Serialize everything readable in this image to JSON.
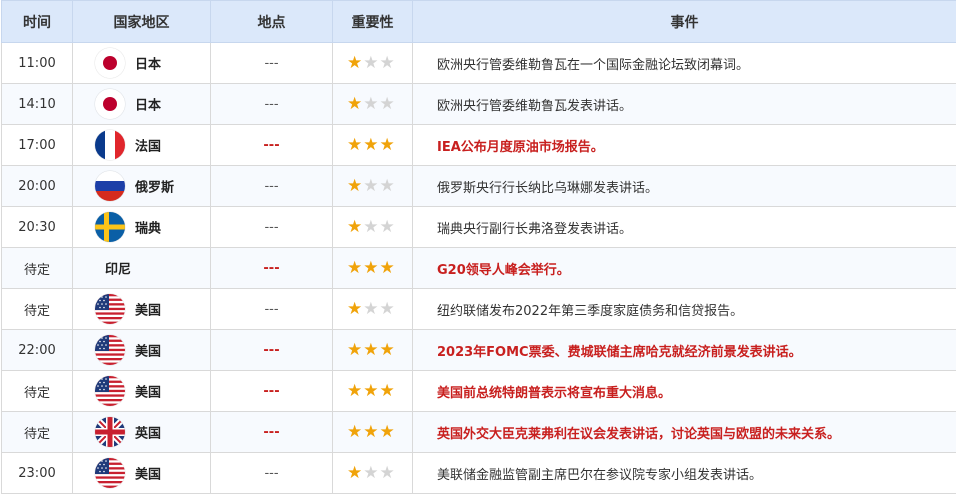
{
  "header": {
    "time": "时间",
    "country": "国家地区",
    "place": "地点",
    "importance": "重要性",
    "event": "事件"
  },
  "rows": [
    {
      "time": "11:00",
      "country": "日本",
      "flag": "japan-flag-icon",
      "place": "---",
      "stars": 1,
      "event": "欧洲央行管委维勒鲁瓦在一个国际金融论坛致闭幕词。",
      "highlight": false
    },
    {
      "time": "14:10",
      "country": "日本",
      "flag": "japan-flag-icon",
      "place": "---",
      "stars": 1,
      "event": "欧洲央行管委维勒鲁瓦发表讲话。",
      "highlight": false
    },
    {
      "time": "17:00",
      "country": "法国",
      "flag": "france-flag-icon",
      "place": "---",
      "stars": 3,
      "event": "IEA公布月度原油市场报告。",
      "highlight": true
    },
    {
      "time": "20:00",
      "country": "俄罗斯",
      "flag": "russia-flag-icon",
      "place": "---",
      "stars": 1,
      "event": "俄罗斯央行行长纳比乌琳娜发表讲话。",
      "highlight": false
    },
    {
      "time": "20:30",
      "country": "瑞典",
      "flag": "sweden-flag-icon",
      "place": "---",
      "stars": 1,
      "event": "瑞典央行副行长弗洛登发表讲话。",
      "highlight": false
    },
    {
      "time": "待定",
      "country": "印尼",
      "flag": "",
      "place": "---",
      "stars": 3,
      "event": "G20领导人峰会举行。",
      "highlight": true
    },
    {
      "time": "待定",
      "country": "美国",
      "flag": "usa-flag-icon",
      "place": "---",
      "stars": 1,
      "event": "纽约联储发布2022年第三季度家庭债务和信贷报告。",
      "highlight": false
    },
    {
      "time": "22:00",
      "country": "美国",
      "flag": "usa-flag-icon",
      "place": "---",
      "stars": 3,
      "event": "2023年FOMC票委、费城联储主席哈克就经济前景发表讲话。",
      "highlight": true
    },
    {
      "time": "待定",
      "country": "美国",
      "flag": "usa-flag-icon",
      "place": "---",
      "stars": 3,
      "event": "美国前总统特朗普表示将宣布重大消息。",
      "highlight": true
    },
    {
      "time": "待定",
      "country": "英国",
      "flag": "uk-flag-icon",
      "place": "---",
      "stars": 3,
      "event": "英国外交大臣克莱弗利在议会发表讲话，讨论英国与欧盟的未来关系。",
      "highlight": true
    },
    {
      "time": "23:00",
      "country": "美国",
      "flag": "usa-flag-icon",
      "place": "---",
      "stars": 1,
      "event": "美联储金融监管副主席巴尔在参议院专家小组发表讲话。",
      "highlight": false
    }
  ],
  "colors": {
    "header_bg": "#dbe8fa",
    "highlight": "#c8201f",
    "star_on": "#f0a30a",
    "star_off": "#d4d4d4"
  }
}
